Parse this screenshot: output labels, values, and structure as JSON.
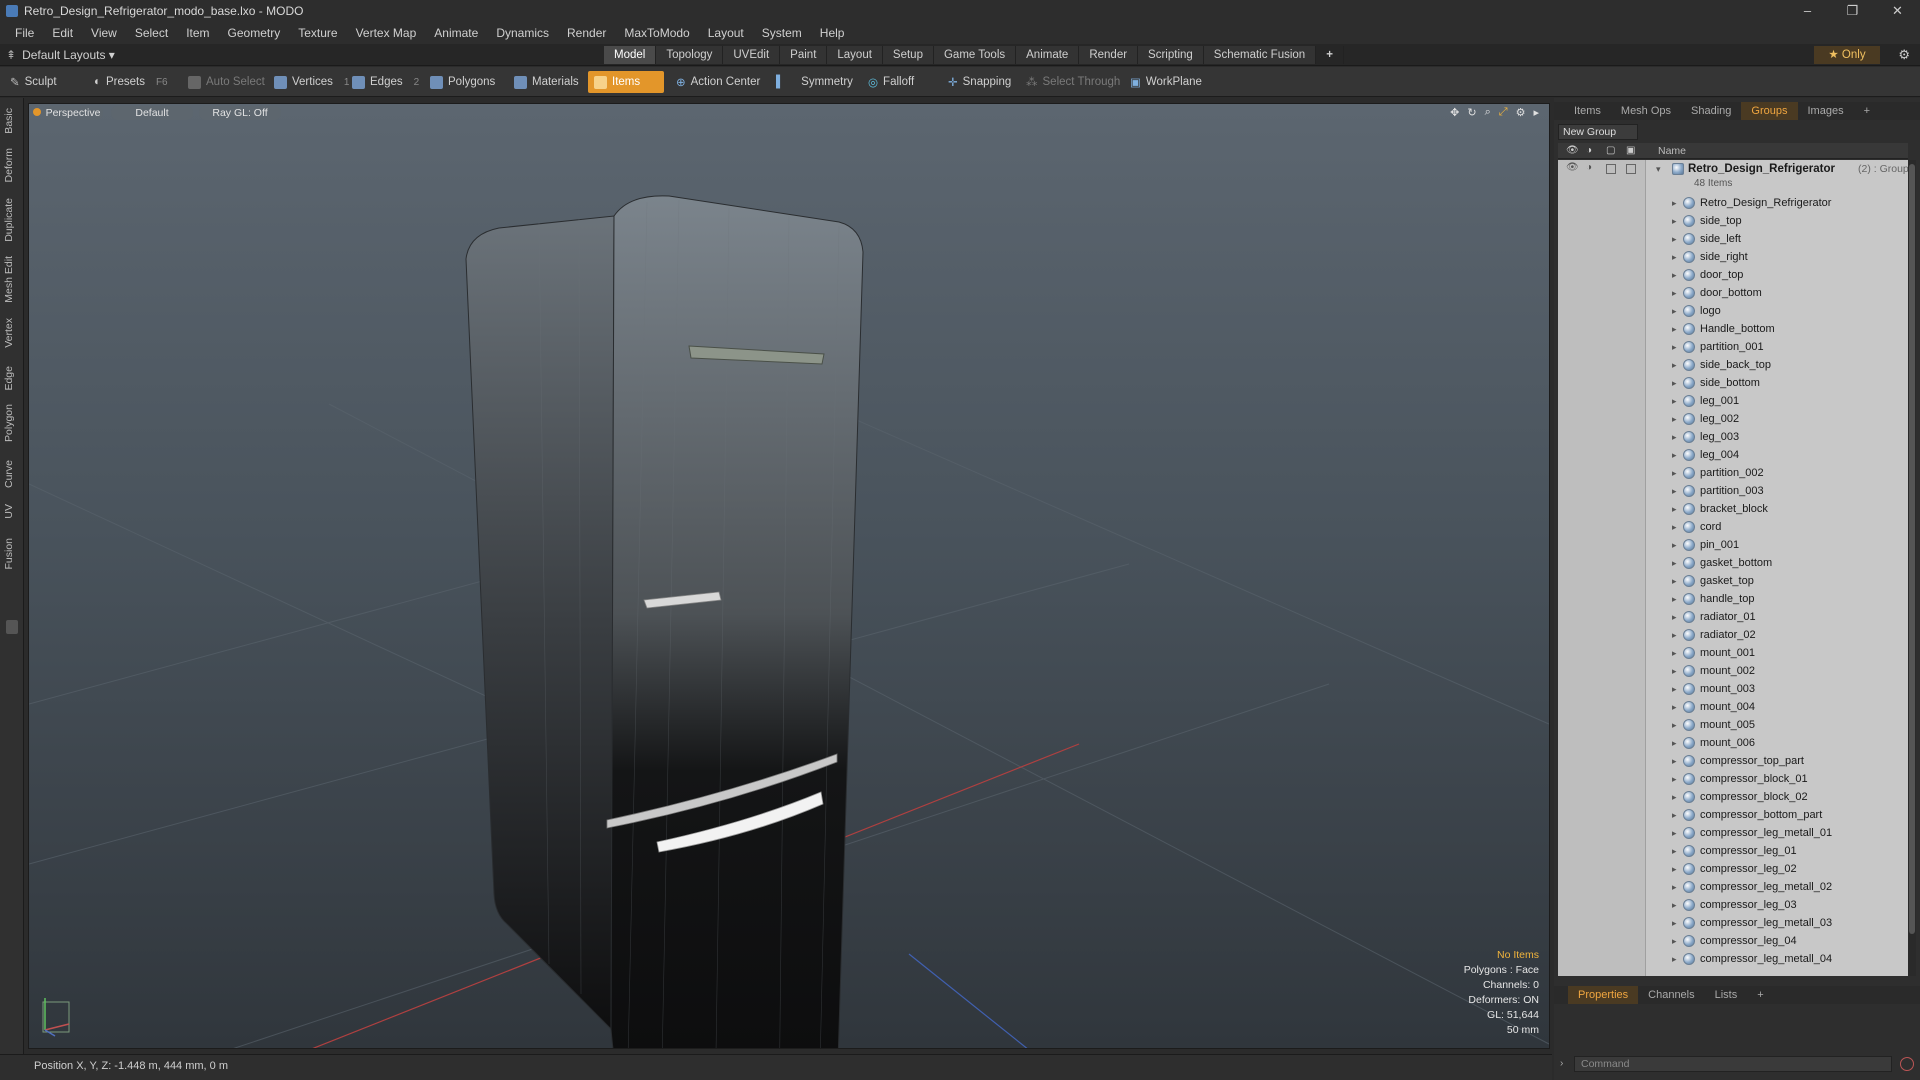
{
  "window": {
    "title": "Retro_Design_Refrigerator_modo_base.lxo - MODO",
    "controls": [
      "–",
      "❐",
      "✕"
    ]
  },
  "menubar": [
    "File",
    "Edit",
    "View",
    "Select",
    "Item",
    "Geometry",
    "Texture",
    "Vertex Map",
    "Animate",
    "Dynamics",
    "Render",
    "MaxToModo",
    "Layout",
    "System",
    "Help"
  ],
  "layoutbar": {
    "layouts_label": "Default Layouts ▾",
    "tabs": [
      "Model",
      "Topology",
      "UVEdit",
      "Paint",
      "Layout",
      "Setup",
      "Game Tools",
      "Animate",
      "Render",
      "Scripting",
      "Schematic Fusion"
    ],
    "active_tab": "Model",
    "add_tab": "+",
    "only_label": "★  Only"
  },
  "toolbar": {
    "sculpt": "Sculpt",
    "presets": "Presets",
    "presets_key": "F6",
    "auto_select": "Auto Select",
    "vertices": "Vertices",
    "vertices_count": "1",
    "edges": "Edges",
    "edges_count": "2",
    "polygons": "Polygons",
    "materials": "Materials",
    "items": "Items",
    "action_center": "Action Center",
    "symmetry": "Symmetry",
    "falloff": "Falloff",
    "snapping": "Snapping",
    "select_through": "Select Through",
    "workplane": "WorkPlane"
  },
  "left_tabs": [
    "Basic",
    "Deform",
    "Duplicate",
    "Mesh Edit",
    "Vertex",
    "Edge",
    "Polygon",
    "Curve",
    "UV",
    "Fusion"
  ],
  "viewport": {
    "view_label": "Perspective",
    "shading_label": "Default",
    "raygl_label": "Ray GL: Off",
    "info": {
      "selection": "No Items",
      "polygons": "Polygons : Face",
      "channels": "Channels: 0",
      "deformers": "Deformers: ON",
      "gl": "GL: 51,644",
      "scale": "50 mm"
    }
  },
  "right_panel": {
    "tabs": [
      "Items",
      "Mesh Ops",
      "Shading",
      "Groups",
      "Images",
      "+"
    ],
    "active_tab": "Groups",
    "new_group": "New Group",
    "column_name": "Name",
    "group": {
      "name": "Retro_Design_Refrigerator",
      "meta": "(2) : Group",
      "count": "48 Items",
      "items": [
        "Retro_Design_Refrigerator",
        "side_top",
        "side_left",
        "side_right",
        "door_top",
        "door_bottom",
        "logo",
        "Handle_bottom",
        "partition_001",
        "side_back_top",
        "side_bottom",
        "leg_001",
        "leg_002",
        "leg_003",
        "leg_004",
        "partition_002",
        "partition_003",
        "bracket_block",
        "cord",
        "pin_001",
        "gasket_bottom",
        "gasket_top",
        "handle_top",
        "radiator_01",
        "radiator_02",
        "mount_001",
        "mount_002",
        "mount_003",
        "mount_004",
        "mount_005",
        "mount_006",
        "compressor_top_part",
        "compressor_block_01",
        "compressor_block_02",
        "compressor_bottom_part",
        "compressor_leg_metall_01",
        "compressor_leg_01",
        "compressor_leg_02",
        "compressor_leg_metall_02",
        "compressor_leg_03",
        "compressor_leg_metall_03",
        "compressor_leg_04",
        "compressor_leg_metall_04"
      ]
    },
    "bottom_tabs": [
      "Properties",
      "Channels",
      "Lists",
      "+"
    ],
    "bottom_active": "Properties",
    "command_placeholder": "Command"
  },
  "statusbar": {
    "position": "Position X, Y, Z:   -1.448 m, 444 mm, 0 m"
  }
}
